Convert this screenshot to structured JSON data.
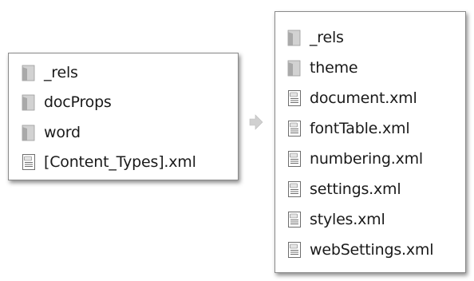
{
  "source_panel": {
    "items": [
      {
        "label": "_rels",
        "icon": "folder-icon"
      },
      {
        "label": "docProps",
        "icon": "folder-icon"
      },
      {
        "label": "word",
        "icon": "folder-icon"
      },
      {
        "label": "[Content_Types].xml",
        "icon": "xml-file-icon"
      }
    ]
  },
  "word_panel": {
    "items": [
      {
        "label": "_rels",
        "icon": "folder-icon"
      },
      {
        "label": "theme",
        "icon": "folder-icon"
      },
      {
        "label": "document.xml",
        "icon": "xml-file-icon"
      },
      {
        "label": "fontTable.xml",
        "icon": "xml-file-icon"
      },
      {
        "label": "numbering.xml",
        "icon": "xml-file-icon"
      },
      {
        "label": "settings.xml",
        "icon": "xml-file-icon"
      },
      {
        "label": "styles.xml",
        "icon": "xml-file-icon"
      },
      {
        "label": "webSettings.xml",
        "icon": "xml-file-icon"
      }
    ]
  },
  "connector": {
    "icon": "arrow-right-icon"
  },
  "colors": {
    "folder": "#b9b9b9",
    "border": "#8a8a8a",
    "arrow": "#cfcfcf"
  }
}
